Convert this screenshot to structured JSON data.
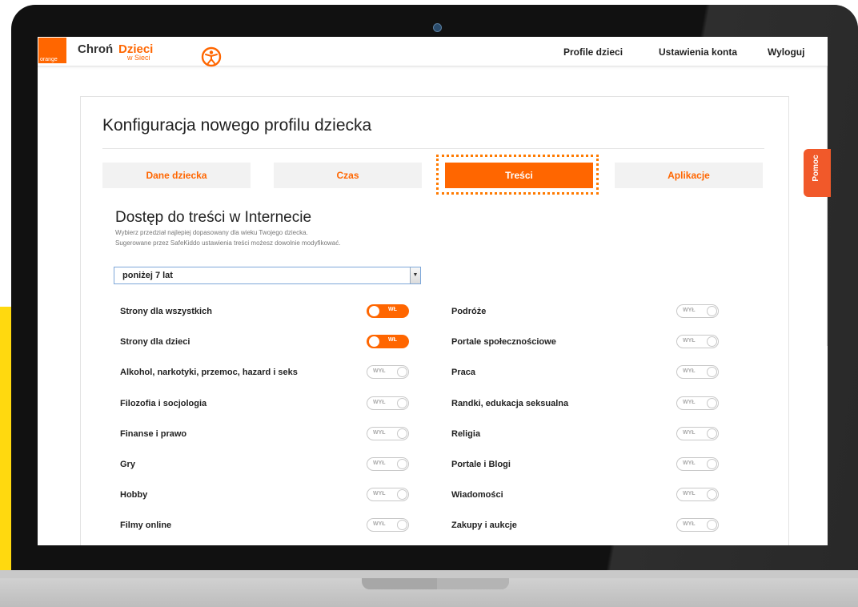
{
  "brand": {
    "orange_logo_text": "orange",
    "chron": "Chroń",
    "dzieci": "Dzieci",
    "w_sieci": "w Sieci"
  },
  "nav": {
    "items": [
      "Profile dzieci",
      "Ustawienia konta",
      "Wyloguj"
    ]
  },
  "page": {
    "title": "Konfiguracja nowego profilu dziecka"
  },
  "steps": [
    {
      "label": "Dane dziecka",
      "active": false
    },
    {
      "label": "Czas",
      "active": false
    },
    {
      "label": "Treści",
      "active": true
    },
    {
      "label": "Aplikacje",
      "active": false
    }
  ],
  "section": {
    "title": "Dostęp do treści w Internecie",
    "subtitle1": "Wybierz przedział najlepiej dopasowany dla wieku Twojego dziecka.",
    "subtitle2": "Sugerowane przez SafeKiddo ustawienia treści możesz dowolnie modyfikować."
  },
  "age_select": {
    "value": "poniżej 7 lat"
  },
  "toggle_text": {
    "on": "WŁ",
    "off": "WYŁ"
  },
  "categories_left": [
    {
      "label": "Strony dla wszystkich",
      "on": true
    },
    {
      "label": "Strony dla dzieci",
      "on": true
    },
    {
      "label": "Alkohol, narkotyki, przemoc, hazard i seks",
      "on": false
    },
    {
      "label": "Filozofia i socjologia",
      "on": false
    },
    {
      "label": "Finanse i prawo",
      "on": false
    },
    {
      "label": "Gry",
      "on": false
    },
    {
      "label": "Hobby",
      "on": false
    },
    {
      "label": "Filmy online",
      "on": false
    }
  ],
  "categories_right": [
    {
      "label": "Podróże",
      "on": false
    },
    {
      "label": "Portale społecznościowe",
      "on": false
    },
    {
      "label": "Praca",
      "on": false
    },
    {
      "label": "Randki, edukacja seksualna",
      "on": false
    },
    {
      "label": "Religia",
      "on": false
    },
    {
      "label": "Portale i Blogi",
      "on": false
    },
    {
      "label": "Wiadomości",
      "on": false
    },
    {
      "label": "Zakupy i aukcje",
      "on": false
    }
  ],
  "help_tab": {
    "label": "Pomoc"
  },
  "colors": {
    "accent": "#ff6600",
    "help": "#f1592a",
    "yellow": "#ffd90f"
  }
}
